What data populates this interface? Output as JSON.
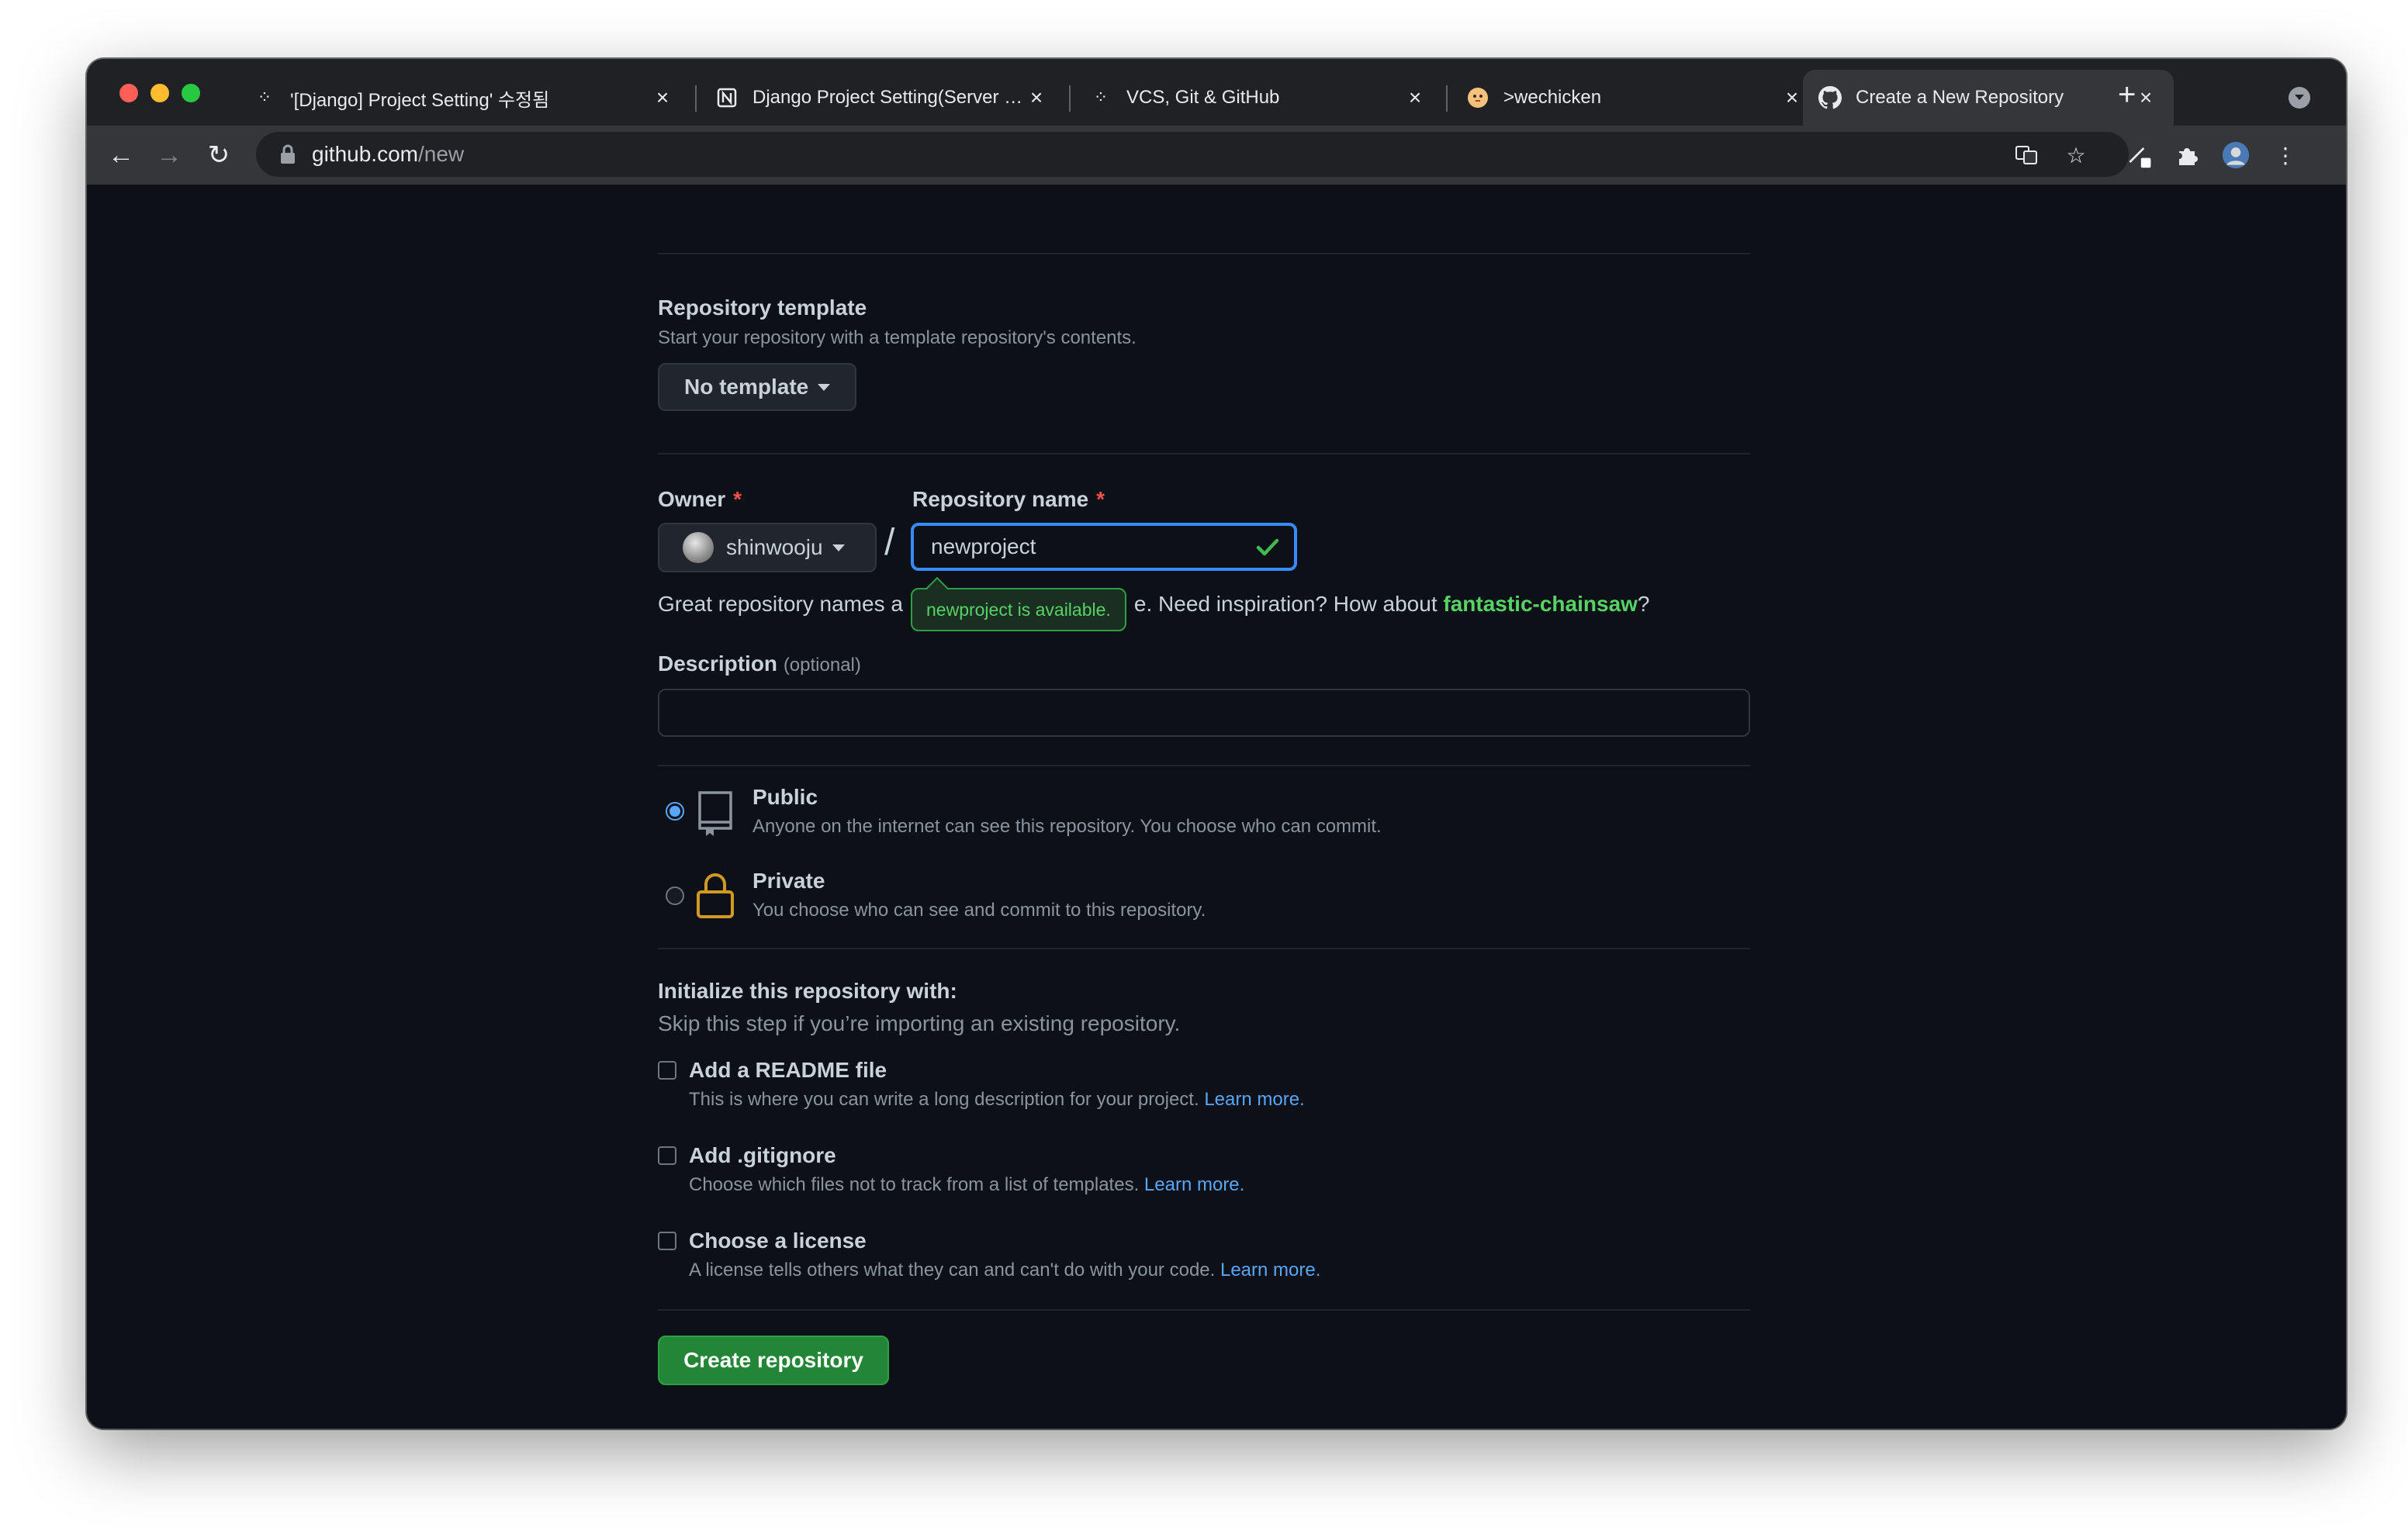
{
  "browser": {
    "tabs": [
      {
        "title": "'[Django] Project Setting' 수정됨",
        "favicon": "tistory-icon"
      },
      {
        "title": "Django Project Setting(Server …",
        "favicon": "notion-icon"
      },
      {
        "title": "VCS, Git & GitHub",
        "favicon": "tistory-icon"
      },
      {
        "title": ">wechicken",
        "favicon": "chick-icon"
      },
      {
        "title": "Create a New Repository",
        "favicon": "github-icon"
      }
    ],
    "url_host": "github.com",
    "url_path": "/new"
  },
  "form": {
    "template": {
      "label": "Repository template",
      "description": "Start your repository with a template repository's contents.",
      "button": "No template"
    },
    "owner": {
      "label": "Owner",
      "required_mark": "*",
      "value": "shinwooju"
    },
    "slash": "/",
    "repo_name": {
      "label": "Repository name",
      "required_mark": "*",
      "value": "newproject",
      "availability": "newproject is available."
    },
    "hint": {
      "prefix": "Great repository names a",
      "suffix": "e. Need inspiration? How about ",
      "suggestion": "fantastic-chainsaw",
      "end": "?"
    },
    "description": {
      "label": "Description",
      "optional": "(optional)",
      "value": ""
    },
    "visibility": {
      "selected": "public",
      "options": [
        {
          "title": "Public",
          "description": "Anyone on the internet can see this repository. You choose who can commit."
        },
        {
          "title": "Private",
          "description": "You choose who can see and commit to this repository."
        }
      ]
    },
    "initialize": {
      "title": "Initialize this repository with:",
      "subtitle": "Skip this step if you’re importing an existing repository.",
      "options": [
        {
          "title": "Add a README file",
          "description": "This is where you can write a long description for your project.",
          "link": "Learn more.",
          "checked": false
        },
        {
          "title": "Add .gitignore",
          "description": "Choose which files not to track from a list of templates.",
          "link": "Learn more.",
          "checked": false
        },
        {
          "title": "Choose a license",
          "description": "A license tells others what they can and can't do with your code.",
          "link": "Learn more.",
          "checked": false
        }
      ]
    },
    "submit": "Create repository"
  },
  "colors": {
    "page_bg": "#0d1117",
    "accent_blue": "#58a6ff",
    "success_green": "#56d364",
    "button_green": "#238636",
    "required_red": "#f85149"
  }
}
